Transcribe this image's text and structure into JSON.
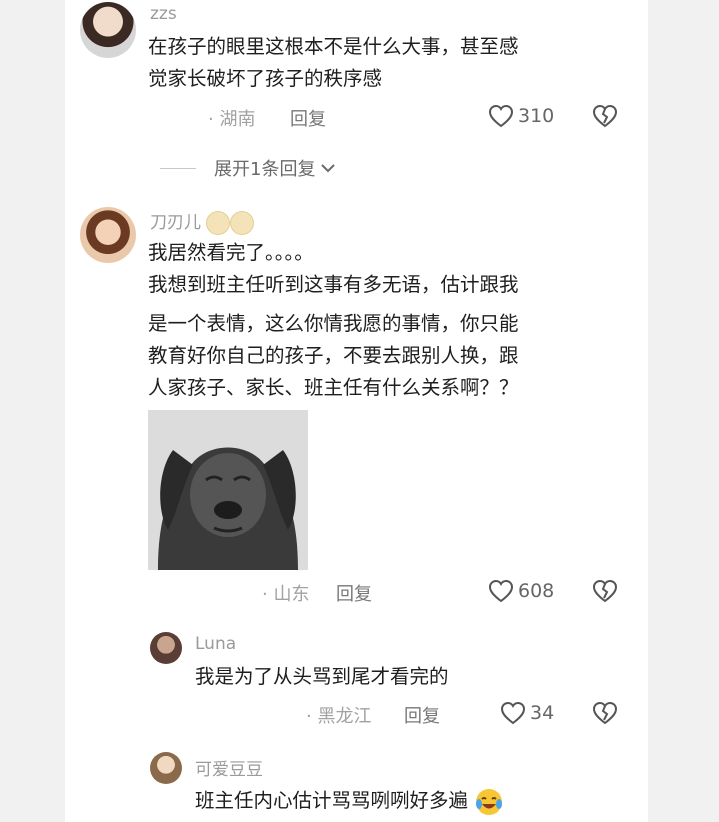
{
  "comments": [
    {
      "username": "zzs",
      "lines": [
        "在孩子的眼里这根本不是什么大事，甚至感",
        "觉家长破坏了孩子的秩序感"
      ],
      "location": "· 湖南",
      "reply_label": "回复",
      "likes": "310"
    },
    {
      "username": "刀刃儿",
      "lines": [
        "我居然看完了。。。。",
        "我想到班主任听到这事有多无语，估计跟我",
        "是一个表情，这么你情我愿的事情，你只能",
        "教育好你自己的孩子，不要去跟别人换，跟",
        "人家孩子、家长、班主任有什么关系啊？？"
      ],
      "location": "· 山东",
      "reply_label": "回复",
      "likes": "608"
    }
  ],
  "expand_label": "展开1条回复",
  "replies": [
    {
      "username": "Luna",
      "text": "我是为了从头骂到尾才看完的",
      "location": "· 黑龙江",
      "reply_label": "回复",
      "likes": "34"
    },
    {
      "username": "可爱豆豆",
      "text": "班主任内心估计骂骂咧咧好多遍"
    }
  ],
  "icons": {
    "like": "heart-outline-icon",
    "dislike": "broken-heart-icon",
    "expand": "chevron-down-icon"
  },
  "colors": {
    "text": "#1e1e1e",
    "meta": "#a2a2a2",
    "background": "#ffffff"
  }
}
